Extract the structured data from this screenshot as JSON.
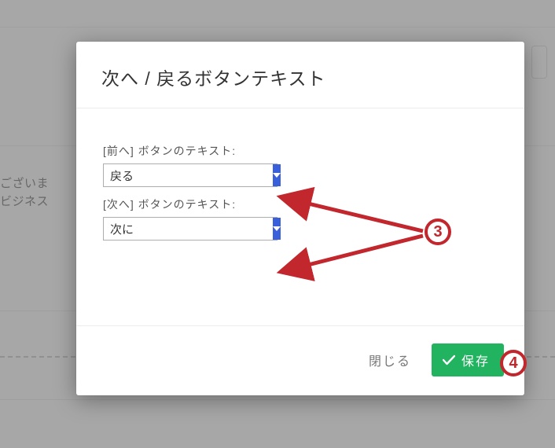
{
  "modal": {
    "title": "次へ / 戻るボタンテキスト",
    "field_prev": {
      "label": "[前へ] ボタンのテキスト:",
      "value": "戻る"
    },
    "field_next": {
      "label": "[次へ] ボタンのテキスト:",
      "value": "次に"
    },
    "close_label": "閉じる",
    "save_label": "保存"
  },
  "background": {
    "left_text_line_1": "ございま",
    "left_text_line_2": "ビジネス"
  },
  "callouts": {
    "c3": "3",
    "c4": "4"
  },
  "colors": {
    "accent_blue": "#3a5fdb",
    "accent_green": "#21b35f",
    "annotation_red": "#c1272d"
  }
}
